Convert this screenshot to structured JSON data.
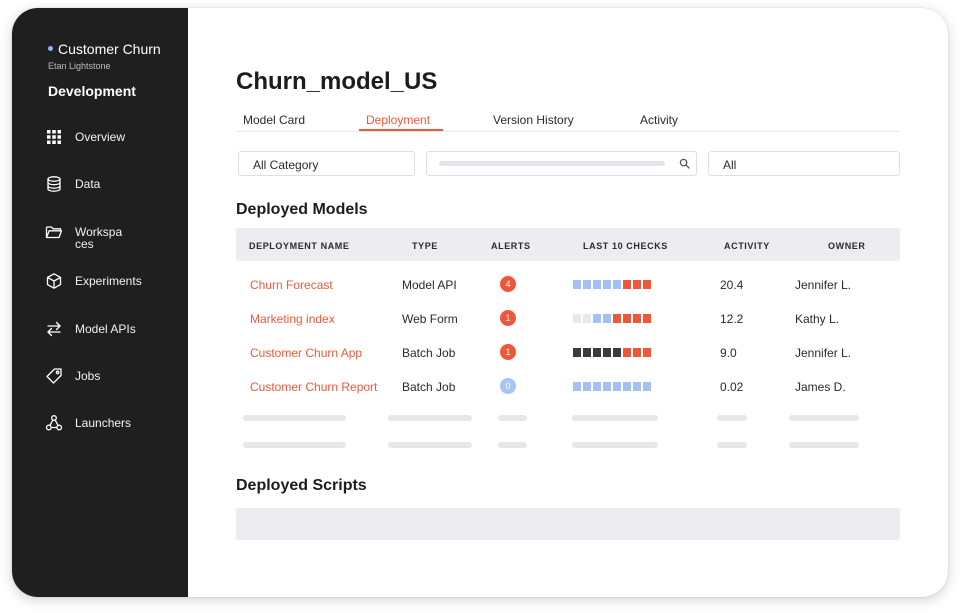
{
  "sidebar": {
    "project": "Customer Churn",
    "user": "Etan Lightstone",
    "section": "Development",
    "items": [
      {
        "label": "Overview",
        "icon": "grid-icon"
      },
      {
        "label": "Data",
        "icon": "database-icon"
      },
      {
        "label": "Workspaces",
        "icon": "folder-icon"
      },
      {
        "label": "Experiments",
        "icon": "cube-icon"
      },
      {
        "label": "Model APIs",
        "icon": "arrows-swap-icon"
      },
      {
        "label": "Jobs",
        "icon": "tag-icon"
      },
      {
        "label": "Launchers",
        "icon": "nodes-icon"
      }
    ]
  },
  "main": {
    "title": "Churn_model_US",
    "tabs": [
      "Model Card",
      "Deployment",
      "Version History",
      "Activity"
    ],
    "active_tab": "Deployment",
    "filters": {
      "category": "All Category",
      "search_placeholder": "",
      "all": "All"
    },
    "deployed_models": {
      "heading": "Deployed Models",
      "columns": [
        "DEPLOYMENT NAME",
        "TYPE",
        "ALERTS",
        "LAST 10 CHECKS",
        "ACTIVITY",
        "OWNER"
      ],
      "rows": [
        {
          "name": "Churn Forecast",
          "type": "Model API",
          "alerts": "4",
          "activity": "20.4",
          "owner": "Jennifer L.",
          "checks": [
            "blue",
            "blue",
            "blue",
            "blue",
            "blue",
            "red",
            "red",
            "red"
          ]
        },
        {
          "name": "Marketing index",
          "type": "Web Form",
          "alerts": "1",
          "activity": "12.2",
          "owner": "Kathy L.",
          "checks": [
            "light",
            "light",
            "blue",
            "blue",
            "red",
            "red",
            "red",
            "red"
          ]
        },
        {
          "name": "Customer Churn App",
          "type": "Batch Job",
          "alerts": "1",
          "activity": "9.0",
          "owner": "Jennifer L.",
          "checks": [
            "dark",
            "dark",
            "dark",
            "dark",
            "dark",
            "red",
            "red",
            "red"
          ]
        },
        {
          "name": "Customer Churn Report",
          "type": "Batch Job",
          "alerts": "0",
          "activity": "0.02",
          "owner": "James D.",
          "checks": [
            "blue",
            "blue",
            "blue",
            "blue",
            "blue",
            "blue",
            "blue",
            "blue"
          ]
        }
      ]
    },
    "deployed_scripts": {
      "heading": "Deployed Scripts"
    }
  },
  "colors": {
    "accent": "#f0573a",
    "alert_badge": "#f0573a",
    "alert_zero": "#a8c4f0",
    "check_blue": "#a3c1f2",
    "check_red": "#f0573a",
    "check_dark": "#3a3a40",
    "check_light": "#e8e8ee",
    "sidebar_bg": "#1f1f1f"
  }
}
